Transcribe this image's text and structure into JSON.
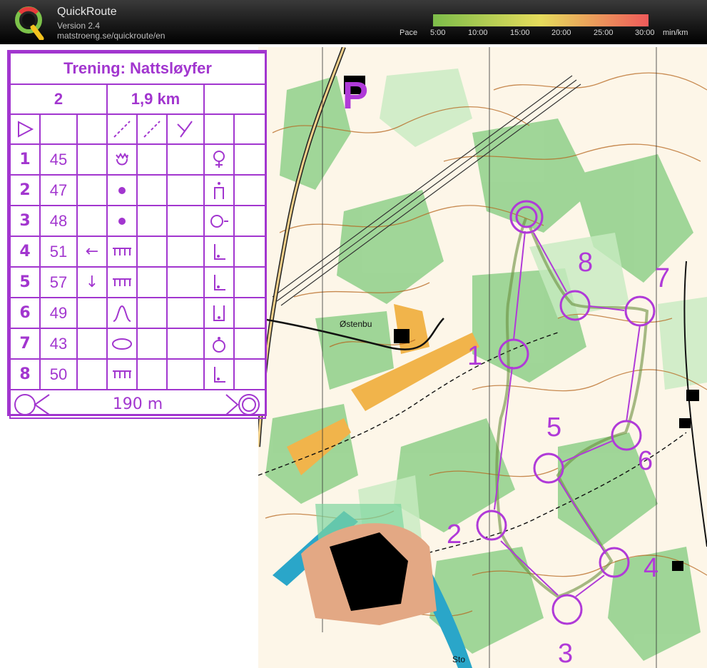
{
  "app": {
    "title": "QuickRoute",
    "version": "Version 2.4",
    "url": "matstroeng.se/quickroute/en"
  },
  "pace_legend": {
    "label": "Pace",
    "ticks": [
      "5:00",
      "10:00",
      "15:00",
      "20:00",
      "25:00",
      "30:00"
    ],
    "unit": "min/km",
    "colors": {
      "low": "#7dbd4a",
      "mid": "#e6dc5c",
      "high": "#ef5a5a"
    }
  },
  "control_description": {
    "title": "Trening: Nattsløyfer",
    "course": "2",
    "length": "1,9 km",
    "controls": [
      {
        "number": "1",
        "code": "45",
        "direction": "",
        "feature": "rootstock-icon",
        "location": "waterhole-icon"
      },
      {
        "number": "2",
        "code": "47",
        "direction": "",
        "feature": "dot-icon",
        "location": "foot-icon"
      },
      {
        "number": "3",
        "code": "48",
        "direction": "",
        "feature": "dot-icon",
        "location": "side-icon"
      },
      {
        "number": "4",
        "code": "51",
        "direction": "←",
        "feature": "rootstock-bar-icon",
        "location": "foot-corner-icon"
      },
      {
        "number": "5",
        "code": "57",
        "direction": "↓",
        "feature": "rootstock-bar-icon",
        "location": "foot-corner-icon"
      },
      {
        "number": "6",
        "code": "49",
        "direction": "",
        "feature": "knoll-icon",
        "location": "between-icon"
      },
      {
        "number": "7",
        "code": "43",
        "direction": "",
        "feature": "oval-icon",
        "location": "top-icon"
      },
      {
        "number": "8",
        "code": "50",
        "direction": "",
        "feature": "rootstock-bar-icon",
        "location": "foot-corner-icon"
      }
    ],
    "finish_distance": "190 m"
  },
  "map": {
    "place_name": "Østenbu",
    "place_name_2": "Sto",
    "parking_label": "P",
    "course_color": "#b03ad8",
    "control_labels": [
      "1",
      "2",
      "3",
      "4",
      "5",
      "6",
      "7",
      "8"
    ]
  }
}
